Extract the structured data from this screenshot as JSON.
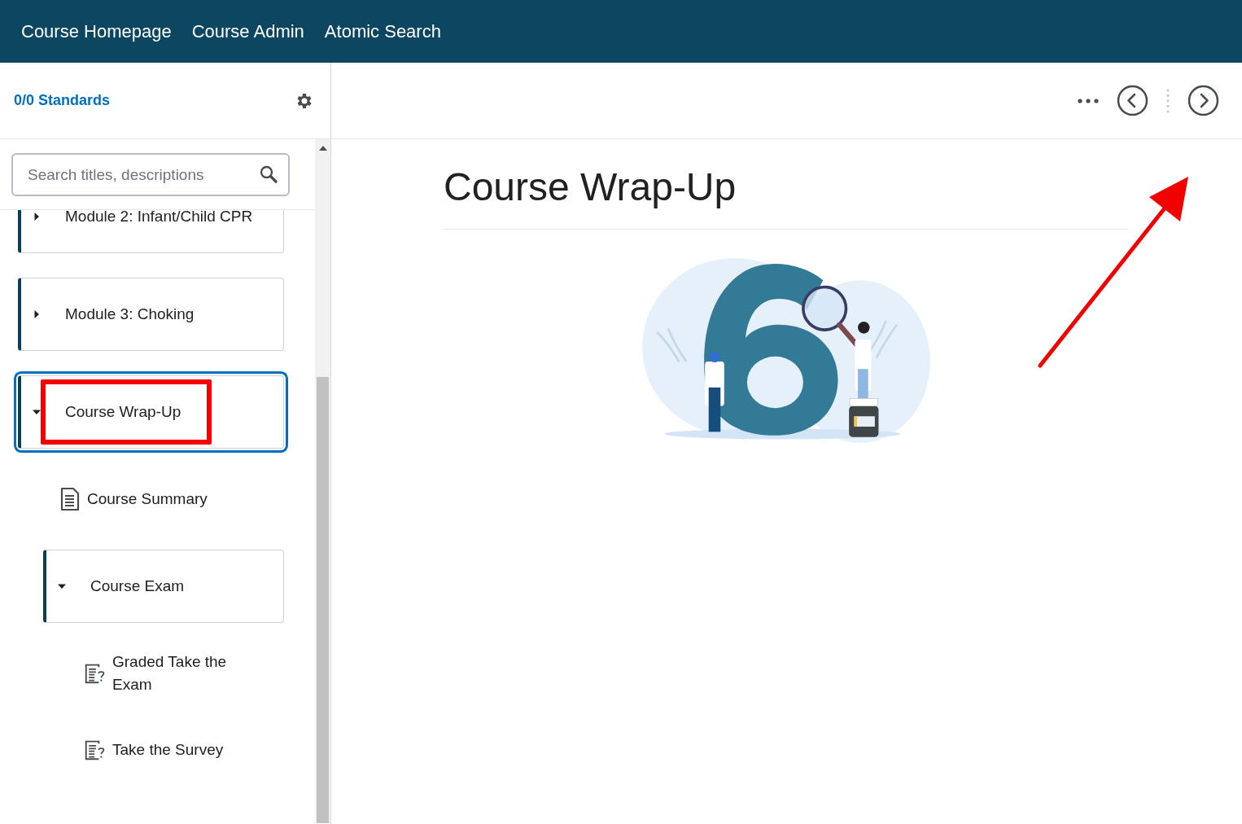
{
  "top_nav": {
    "links": [
      "Course Homepage",
      "Course Admin",
      "Atomic Search"
    ]
  },
  "sidebar": {
    "standards_link": "0/0 Standards",
    "search": {
      "placeholder": "Search titles, descriptions"
    },
    "tree": [
      {
        "kind": "module",
        "label": "Module 2: Infant/Child CPR",
        "expanded": false,
        "selected": false
      },
      {
        "kind": "module",
        "label": "Module 3: Choking",
        "expanded": false,
        "selected": false
      },
      {
        "kind": "module",
        "label": "Course Wrap-Up",
        "expanded": true,
        "selected": true,
        "children": [
          {
            "kind": "document",
            "label": "Course Summary",
            "selected": false
          },
          {
            "kind": "module",
            "label": "Course Exam",
            "expanded": true,
            "selected": false,
            "children": [
              {
                "kind": "quiz",
                "label": "Graded Take the Exam",
                "selected": false
              },
              {
                "kind": "quiz",
                "label": "Take the Survey",
                "selected": false
              }
            ]
          }
        ]
      }
    ]
  },
  "content": {
    "title": "Course Wrap-Up"
  }
}
